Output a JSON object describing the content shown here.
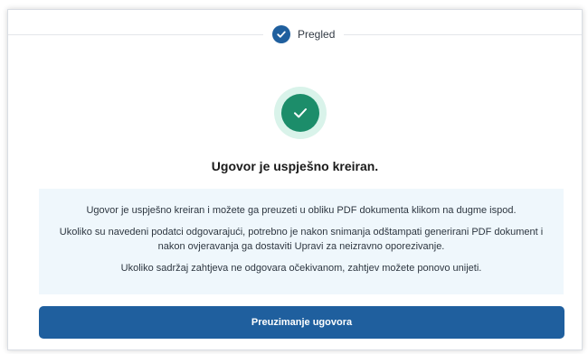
{
  "stepper": {
    "step_label": "Pregled",
    "step_icon": "check-icon",
    "step_color": "#1f5f9e"
  },
  "status": {
    "icon": "success-check-icon",
    "icon_color": "#1c8d6a",
    "headline": "Ugovor je uspješno kreiran."
  },
  "info": {
    "paragraphs": [
      "Ugovor je uspješno kreiran i možete ga preuzeti u obliku PDF dokumenta klikom na dugme ispod.",
      "Ukoliko su navedeni podatci odgovarajući, potrebno je nakon snimanja odštampati generirani PDF dokument i nakon ovjeravanja ga dostaviti Upravi za neizravno oporezivanje.",
      "Ukoliko sadržaj zahtjeva ne odgovara očekivanom, zahtjev možete ponovo unijeti."
    ]
  },
  "actions": {
    "download_label": "Preuzimanje ugovora",
    "button_color": "#1f5f9e"
  }
}
